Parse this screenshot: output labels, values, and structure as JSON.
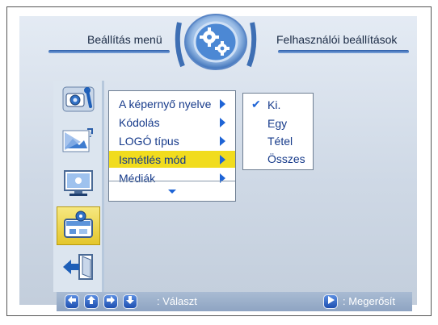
{
  "header": {
    "left_title": "Beállítás menü",
    "right_title": "Felhasználói beállítások",
    "emblem_icon": "gear-icon"
  },
  "sidebar": {
    "items": [
      {
        "icon": "camera-settings-icon"
      },
      {
        "icon": "slideshow-icon"
      },
      {
        "icon": "screen-settings-icon"
      },
      {
        "icon": "user-settings-icon",
        "active": true
      },
      {
        "icon": "exit-icon"
      }
    ]
  },
  "menu": {
    "items": [
      {
        "label": "A képernyő nyelve"
      },
      {
        "label": "Kódolás"
      },
      {
        "label": "LOGÓ típus"
      },
      {
        "label": "Ismétlés mód",
        "selected": true
      },
      {
        "label": "Médiák"
      }
    ],
    "more_icon": "chevron-down-icon"
  },
  "submenu": {
    "items": [
      {
        "label": "Ki.",
        "checked": true
      },
      {
        "label": "Egy"
      },
      {
        "label": "Tétel"
      },
      {
        "label": "Összes"
      }
    ]
  },
  "footer": {
    "select_label": ": Választ",
    "confirm_label": ": Megerősít"
  },
  "colors": {
    "selection": "#f1dc1e",
    "menu_text": "#163a8a",
    "accent": "#1e64d6"
  }
}
